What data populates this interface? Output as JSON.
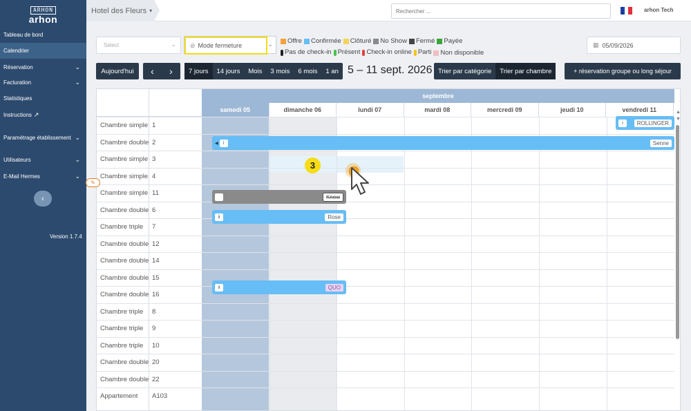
{
  "sidebar": {
    "logo_mark": "ARHON",
    "logo_text": "arhon",
    "items": [
      {
        "label": "Tableau de bord",
        "chevron": false
      },
      {
        "label": "Calendrier",
        "chevron": false,
        "active": true
      },
      {
        "label": "Réservation",
        "chevron": true
      },
      {
        "label": "Facturation",
        "chevron": true
      },
      {
        "label": "Statistiques",
        "chevron": false
      },
      {
        "label": "Instructions",
        "chevron": false
      },
      {
        "label": "Paramétrage établissement",
        "chevron": true
      },
      {
        "label": "Utilisateurs",
        "chevron": true
      },
      {
        "label": "E-Mail Hermes",
        "chevron": true
      }
    ],
    "collapse_glyph": "‹",
    "version": "Version 1.7.4"
  },
  "topbar": {
    "hotel": "Hotel des Fleurs",
    "search_placeholder": "Rechercher ...",
    "user": "arhon Tech"
  },
  "filters": {
    "category_placeholder": "Select",
    "mode": "Mode fermeture",
    "date": "05/09/2026"
  },
  "legend": [
    {
      "kind": "sq",
      "color": "#f5a23a",
      "label": "Offre"
    },
    {
      "kind": "sq",
      "color": "#67bdf5",
      "label": "Confirmée"
    },
    {
      "kind": "sq",
      "color": "#f5d35b",
      "label": "Clôturé"
    },
    {
      "kind": "sq",
      "color": "#8a8a8a",
      "label": "No Show"
    },
    {
      "kind": "sq",
      "color": "#444444",
      "label": "Fermé"
    },
    {
      "kind": "sq",
      "color": "#3aa53a",
      "label": "Payée"
    },
    {
      "kind": "pic",
      "color": "#222222",
      "label": "Pas de check-in"
    },
    {
      "kind": "pic",
      "color": "#47c447",
      "label": "Présent"
    },
    {
      "kind": "pic",
      "color": "#e0443a",
      "label": "Check-in online"
    },
    {
      "kind": "pic",
      "color": "#f5c518",
      "label": "Parti"
    },
    {
      "kind": "sq",
      "color": "#f0bfc4",
      "label": "Non disponible"
    }
  ],
  "toolbar": {
    "today": "Aujourd'hui",
    "prev": "‹",
    "next": "›",
    "ranges": [
      "7 jours",
      "14 jours",
      "Mois",
      "3 mois",
      "6 mois",
      "1 an"
    ],
    "active_range": "7 jours",
    "range_title": "5 – 11 sept. 2026",
    "sort_category": "Trier par catégorie",
    "sort_room": "Trier par chambre",
    "group_button": "+ réservation groupe ou long séjour"
  },
  "calendar": {
    "month": "septembre",
    "days": [
      "samedi 05",
      "dimanche 06",
      "lundi 07",
      "mardi 08",
      "mercredi 09",
      "jeudi 10",
      "vendredi 11"
    ],
    "rooms": [
      {
        "type": "Chambre simple",
        "num": "1"
      },
      {
        "type": "Chambre double",
        "num": "2"
      },
      {
        "type": "Chambre simple",
        "num": "3"
      },
      {
        "type": "Chambre simple",
        "num": "4"
      },
      {
        "type": "Chambre simple",
        "num": "11"
      },
      {
        "type": "Chambre double",
        "num": "6"
      },
      {
        "type": "Chambre triple",
        "num": "7"
      },
      {
        "type": "Chambre double",
        "num": "12"
      },
      {
        "type": "Chambre double",
        "num": "14"
      },
      {
        "type": "Chambre double",
        "num": "15"
      },
      {
        "type": "Chambre double",
        "num": "16"
      },
      {
        "type": "Chambre triple",
        "num": "8"
      },
      {
        "type": "Chambre triple",
        "num": "9"
      },
      {
        "type": "Chambre triple",
        "num": "10"
      },
      {
        "type": "Chambre double",
        "num": "20"
      },
      {
        "type": "Chambre double",
        "num": "22"
      },
      {
        "type": "Appartement",
        "num": "A103"
      }
    ],
    "reservations": {
      "r1": "ROLLINGER",
      "r2": "Senne",
      "r3": "Know",
      "r4": "Rose",
      "r5": "QUO"
    }
  },
  "overlay": {
    "step": "3"
  }
}
